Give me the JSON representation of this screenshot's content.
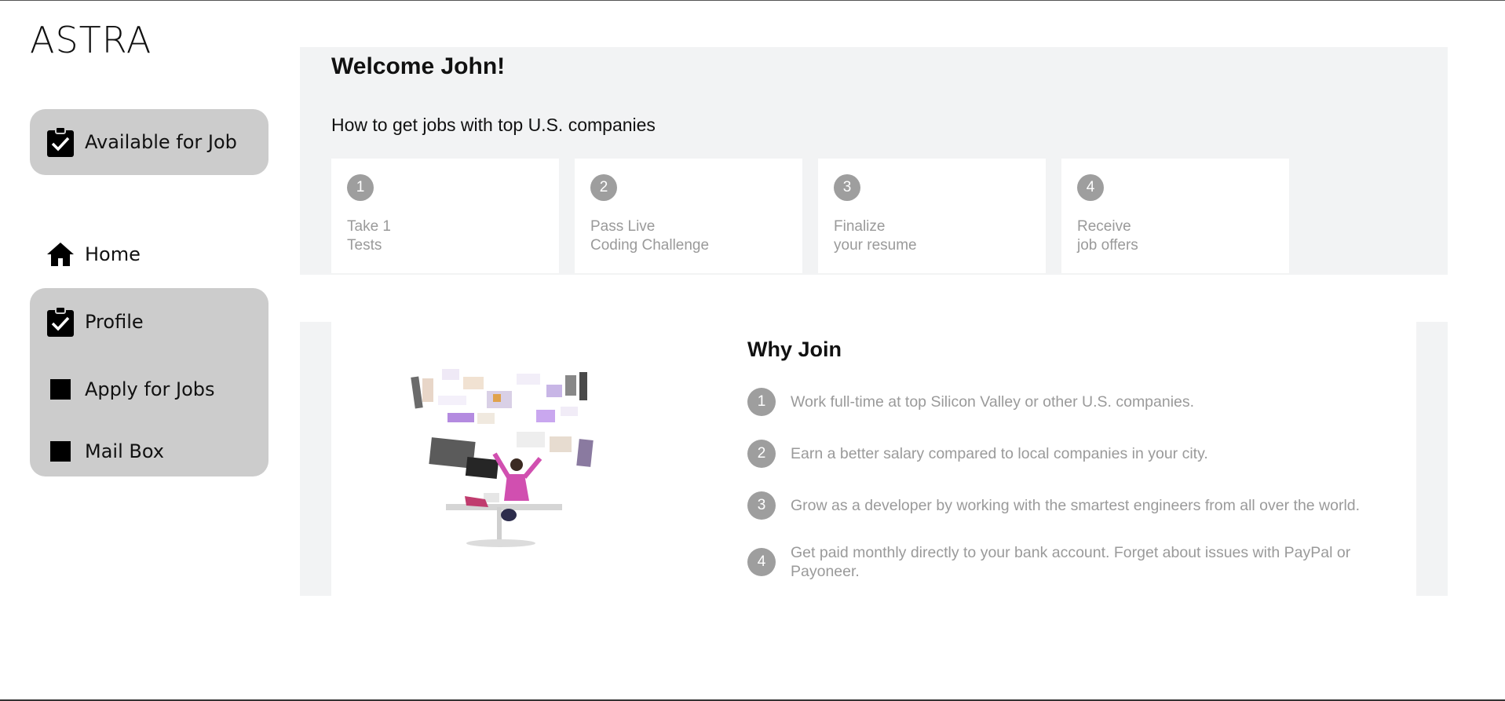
{
  "app": {
    "logo": "ASTRA"
  },
  "sidebar": {
    "availability": {
      "label": "Available for Job",
      "icon": "clipboard-check-icon"
    },
    "nav": [
      {
        "label": "Home",
        "icon": "home-icon"
      },
      {
        "label": "Profile",
        "icon": "clipboard-check-icon"
      },
      {
        "label": "Apply for Jobs",
        "icon": "square-icon"
      },
      {
        "label": "Mail Box",
        "icon": "square-icon"
      }
    ]
  },
  "welcome": {
    "title": "Welcome John!",
    "subtitle": "How to get jobs with top U.S. companies",
    "steps": [
      {
        "number": "1",
        "line1": "Take 1",
        "line2": "Tests"
      },
      {
        "number": "2",
        "line1": "Pass Live",
        "line2": "Coding Challenge"
      },
      {
        "number": "3",
        "line1": "Finalize",
        "line2": "your resume"
      },
      {
        "number": "4",
        "line1": "Receive",
        "line2": "job offers"
      }
    ]
  },
  "why_join": {
    "title": "Why Join",
    "reasons": [
      {
        "number": "1",
        "text": "Work full-time at top Silicon Valley or other U.S. companies."
      },
      {
        "number": "2",
        "text": "Earn a better salary compared to local companies in your city."
      },
      {
        "number": "3",
        "text": "Grow as a developer by working with the smartest engineers from all over the world."
      },
      {
        "number": "4",
        "text": "Get paid monthly directly to your bank account. Forget about issues with PayPal or Payoneer."
      }
    ]
  },
  "colors": {
    "sidebar_highlight": "#cccccc",
    "panel_background": "#f2f3f4",
    "badge": "#9e9e9e",
    "muted_text": "#9a9a9a"
  }
}
